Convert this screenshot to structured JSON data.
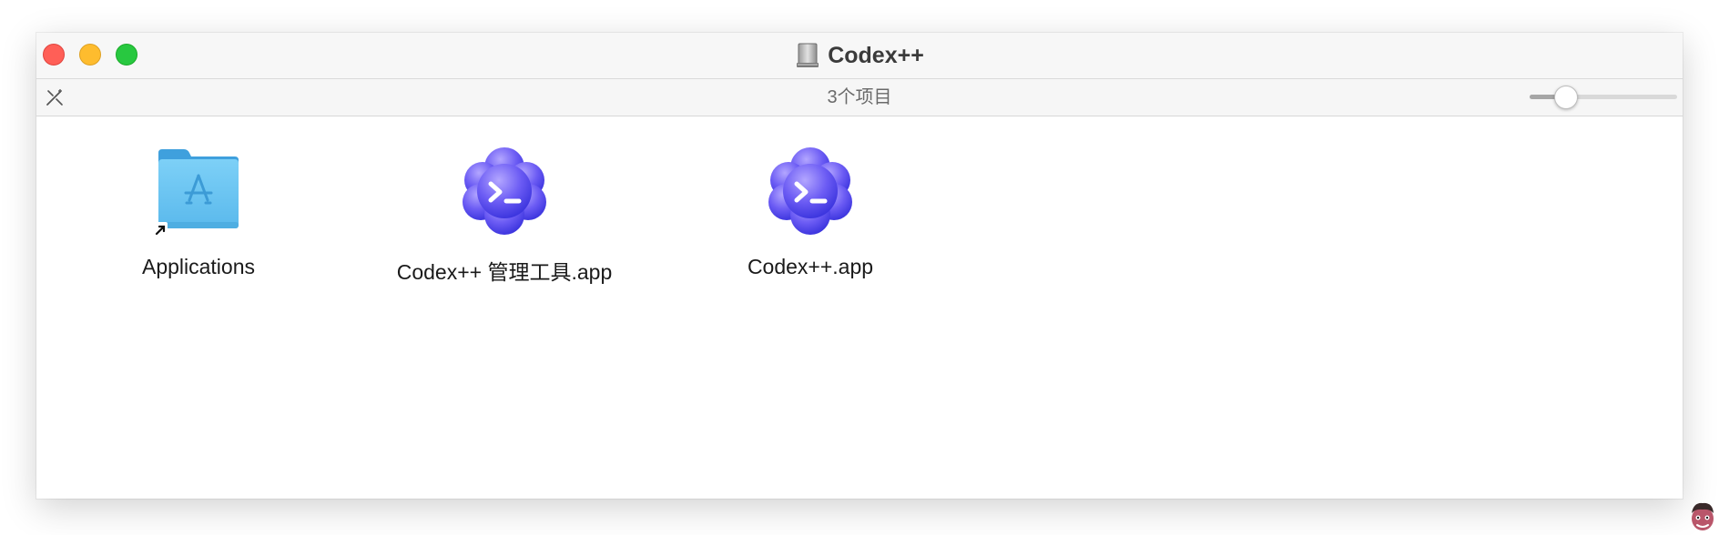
{
  "window": {
    "title": "Codex++",
    "title_icon": "external-drive-icon"
  },
  "toolbar": {
    "status": "3个项目",
    "tool_icon": "wand-icon",
    "icon_size_slider_value_percent": 20
  },
  "items": [
    {
      "label": "Applications",
      "icon": "applications-folder-alias-icon"
    },
    {
      "label": "Codex++ 管理工具.app",
      "icon": "codex-cloud-terminal-icon"
    },
    {
      "label": "Codex++.app",
      "icon": "codex-cloud-terminal-icon"
    }
  ],
  "colors": {
    "close": "#ff5f57",
    "minimize": "#febc2e",
    "zoom": "#28c840",
    "folder_blue": "#6cc4f2",
    "app_purple": "#6457f0"
  }
}
